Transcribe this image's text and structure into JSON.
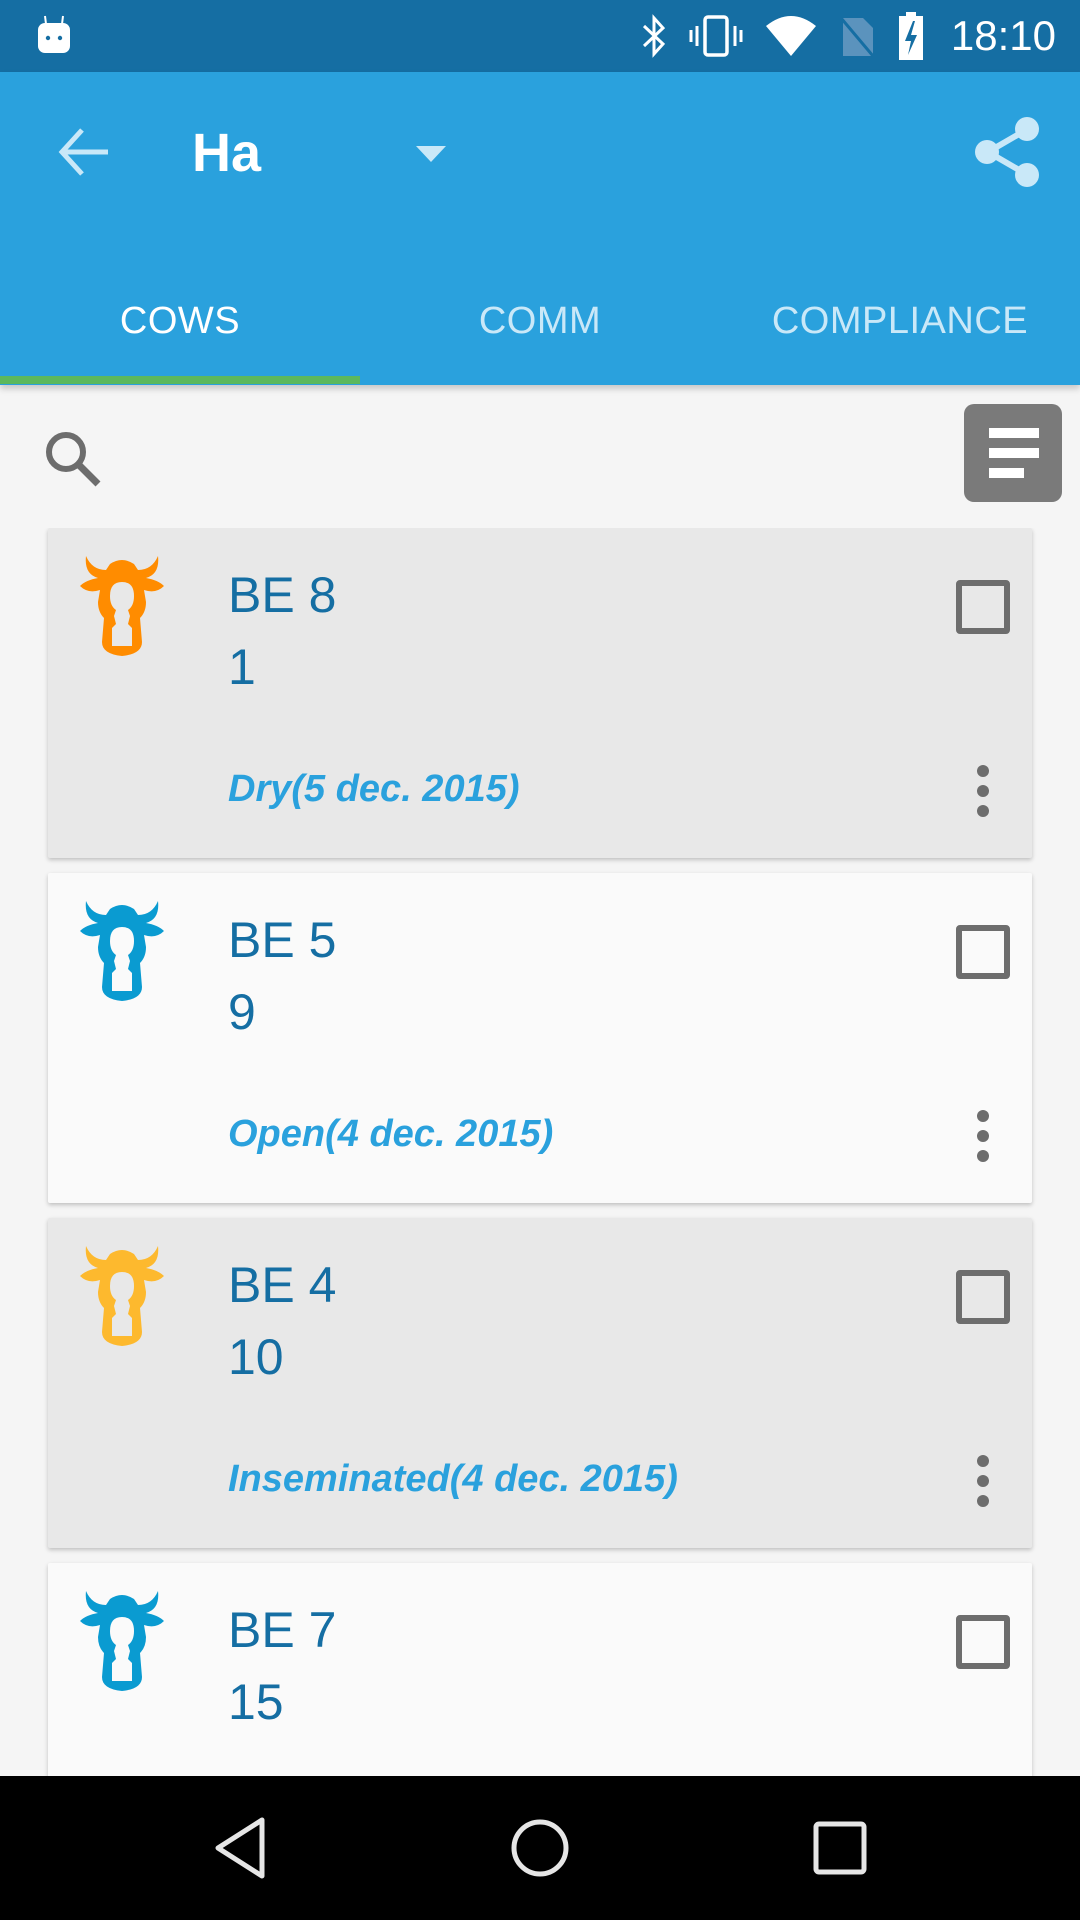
{
  "status_bar": {
    "time": "18:10",
    "icons": [
      "android-notification-icon",
      "bluetooth-icon",
      "vibrate-icon",
      "wifi-icon",
      "no-sim-icon",
      "battery-charging-icon"
    ]
  },
  "app_bar": {
    "title": "Ha",
    "back_icon": "arrow-back-icon",
    "dropdown_icon": "caret-down-icon",
    "share_icon": "share-icon"
  },
  "tabs": [
    {
      "label": "COWS",
      "active": true
    },
    {
      "label": "COMM",
      "active": false
    },
    {
      "label": "COMPLIANCE",
      "active": false
    }
  ],
  "toolbar": {
    "search_icon": "search-icon",
    "filter_icon": "sort-filter-icon"
  },
  "colors": {
    "status_bar": "#156ea3",
    "app_bar": "#2aa1dd",
    "tab_indicator": "#5cb85c",
    "text_primary": "#156ea3",
    "status_text": "#2aa1dd",
    "cow_orange": "#ff8c00",
    "cow_yellow": "#fdb92e",
    "cow_blue": "#0a9bd1"
  },
  "cows": [
    {
      "name": "BE 8",
      "number": "1",
      "status": "Dry(5 dec. 2015)",
      "icon_color": "#ff8c00",
      "card_bg": "#e8e8e8",
      "checked": false
    },
    {
      "name": "BE 5",
      "number": "9",
      "status": "Open(4 dec. 2015)",
      "icon_color": "#0a9bd1",
      "card_bg": "#fafafa",
      "checked": false
    },
    {
      "name": "BE 4",
      "number": "10",
      "status": "Inseminated(4 dec. 2015)",
      "icon_color": "#fdb92e",
      "card_bg": "#e8e8e8",
      "checked": false
    },
    {
      "name": "BE 7",
      "number": "15",
      "status": "",
      "icon_color": "#0a9bd1",
      "card_bg": "#fafafa",
      "checked": false
    }
  ],
  "nav_bar": {
    "back": "nav-back-icon",
    "home": "nav-home-icon",
    "recents": "nav-recents-icon"
  }
}
